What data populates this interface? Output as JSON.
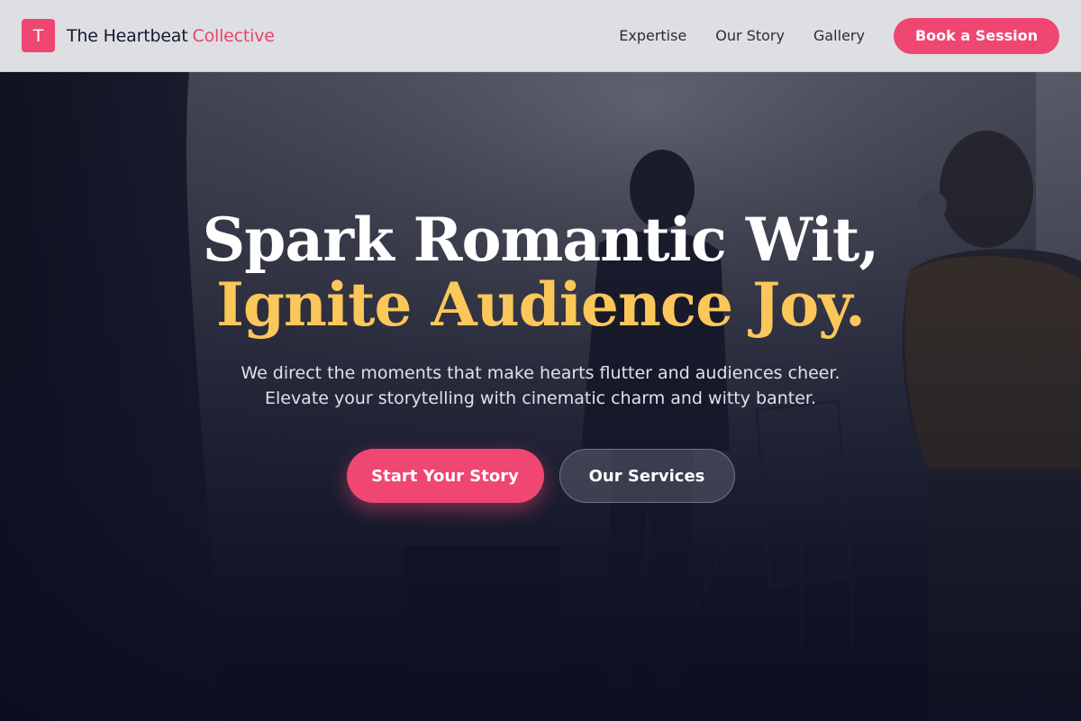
{
  "brand": {
    "logo_letter": "T",
    "name": "The Heartbeat",
    "name_accent": "Collective"
  },
  "nav": {
    "links": [
      "Expertise",
      "Our Story",
      "Gallery"
    ],
    "cta_label": "Book a Session"
  },
  "hero": {
    "headline_line1": "Spark Romantic Wit,",
    "headline_line2": "Ignite Audience Joy.",
    "subtext_line1": "We direct the moments that make hearts flutter and audiences cheer.",
    "subtext_line2": "Elevate your storytelling with cinematic charm and witty banter.",
    "primary_button": "Start Your Story",
    "secondary_button": "Our Services"
  },
  "colors": {
    "accent": "#ef4672",
    "headline_highlight": "#fcc75a",
    "navbar_bg": "#dedfe2",
    "hero_dark": "#111322"
  }
}
